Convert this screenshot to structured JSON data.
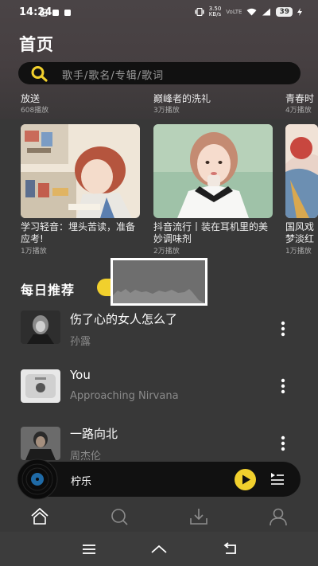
{
  "status_bar": {
    "time": "14:24",
    "net_speed": "3.50\nKB/s",
    "net_type": "VoLTE",
    "battery": "39"
  },
  "header": {
    "title": "首页"
  },
  "search": {
    "placeholder": "歌手/歌名/专辑/歌词"
  },
  "top_row": [
    {
      "title": "放送",
      "plays": "608播放"
    },
    {
      "title": "巅峰者的洗礼",
      "plays": "3万播放"
    },
    {
      "title": "青春时",
      "plays": "4万播放"
    }
  ],
  "playlists": [
    {
      "title": "学习轻音：埋头苦读，准备应考!",
      "plays": "1万播放"
    },
    {
      "title": "抖音流行丨装在耳机里的美妙调味剂",
      "plays": "2万播放"
    },
    {
      "title": "国风戏梦淡红",
      "plays": "1万播放"
    }
  ],
  "daily": {
    "title": "每日推荐"
  },
  "songs": [
    {
      "title": "伤了心的女人怎么了",
      "artist": "孙露"
    },
    {
      "title": "You",
      "artist": "Approaching Nirvana"
    },
    {
      "title": "一路向北",
      "artist": "周杰伦"
    }
  ],
  "player": {
    "title": "柠乐"
  },
  "colors": {
    "accent": "#f1d02d",
    "background": "#383838",
    "search_bg": "#111111"
  },
  "icons": {
    "nav": [
      "home-icon",
      "search-icon",
      "download-icon",
      "user-icon"
    ],
    "system": [
      "menu-icon",
      "home-icon",
      "back-icon"
    ]
  }
}
